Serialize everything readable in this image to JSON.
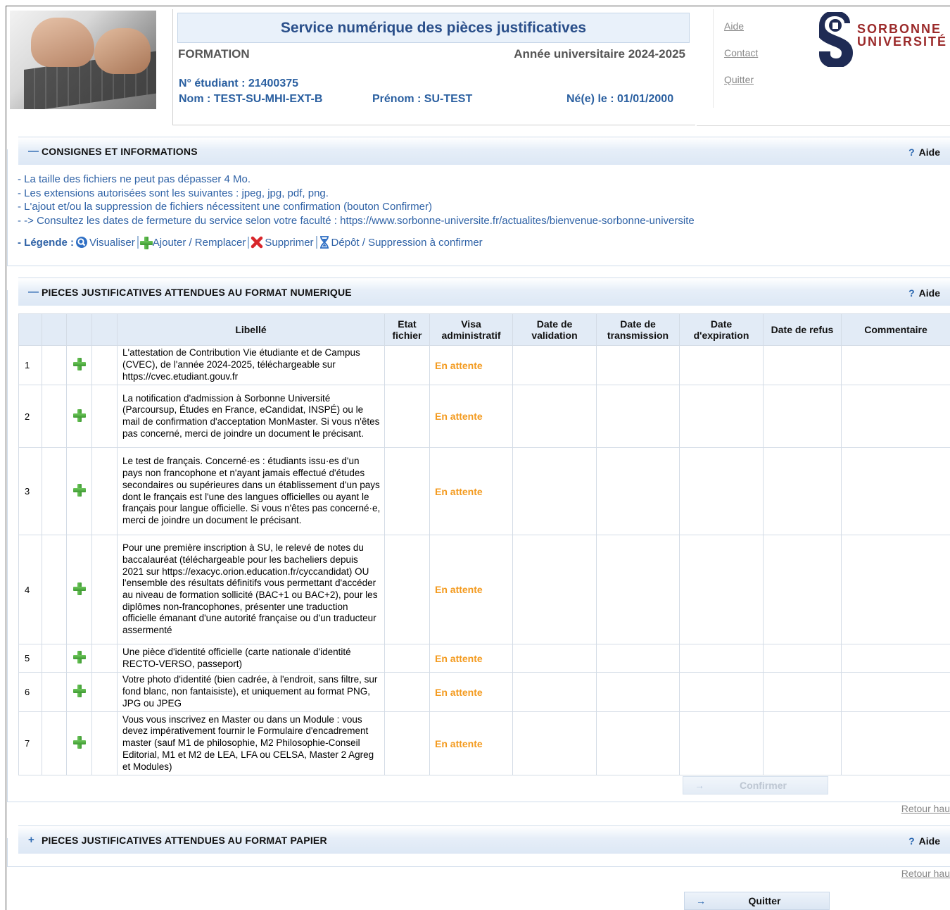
{
  "header": {
    "title": "Service numérique des pièces justificatives",
    "formation": "FORMATION",
    "annee": "Année universitaire 2024-2025",
    "numero_etudiant": "N° étudiant : 21400375",
    "nom": "Nom : TEST-SU-MHI-EXT-B",
    "prenom": "Prénom : SU-TEST",
    "naissance": "Né(e) le : 01/01/2000"
  },
  "links": {
    "aide": "Aide",
    "contact": "Contact",
    "quitter": "Quitter"
  },
  "logo": {
    "line1": "SORBONNE",
    "line2": "UNIVERSITÉ",
    "color": "#9b2a2a"
  },
  "sections": {
    "consignes": {
      "toggle": "—",
      "title": "CONSIGNES ET INFORMATIONS",
      "aide": "Aide",
      "aide_q": "?"
    },
    "numerique": {
      "toggle": "—",
      "title": "PIECES JUSTIFICATIVES ATTENDUES AU FORMAT NUMERIQUE",
      "aide": "Aide",
      "aide_q": "?"
    },
    "papier": {
      "toggle": "+",
      "title": "PIECES JUSTIFICATIVES ATTENDUES AU FORMAT PAPIER",
      "aide": "Aide",
      "aide_q": "?"
    }
  },
  "consignes": [
    "- La taille des fichiers ne peut pas dépasser 4 Mo.",
    "- Les extensions autorisées sont les suivantes : jpeg, jpg, pdf, png.",
    "- L'ajout et/ou la suppression de fichiers nécessitent une confirmation (bouton Confirmer)",
    "- -> Consultez les dates de fermeture du service selon votre faculté : https://www.sorbonne-universite.fr/actualites/bienvenue-sorbonne-universite"
  ],
  "legend": {
    "label": "- Légende :",
    "visualiser": "Visualiser",
    "ajouter": "Ajouter / Remplacer",
    "supprimer": "Supprimer",
    "depot": "Dépôt / Suppression à confirmer"
  },
  "table": {
    "headers": {
      "libelle": "Libellé",
      "etat": "Etat fichier",
      "visa": "Visa administratif",
      "validation": "Date de validation",
      "transmission": "Date de transmission",
      "expiration": "Date d'expiration",
      "refus": "Date de refus",
      "commentaire": "Commentaire"
    },
    "rows": [
      {
        "num": "1",
        "libelle": "L'attestation de Contribution Vie étudiante et de Campus (CVEC), de l'année 2024-2025, téléchargeable sur https://cvec.etudiant.gouv.fr",
        "visa": "En attente"
      },
      {
        "num": "2",
        "libelle": "La notification d'admission à Sorbonne Université (Parcoursup, Études en France, eCandidat, INSPÉ) ou le mail de confirmation d'acceptation MonMaster. Si vous n'êtes pas concerné, merci de joindre un document le précisant.",
        "visa": "En attente"
      },
      {
        "num": "3",
        "libelle": "Le test de français. Concerné·es : étudiants issu·es d'un pays non francophone et n'ayant jamais effectué d'études secondaires ou supérieures dans un établissement d'un pays dont le français est l'une des langues officielles ou ayant le français pour langue officielle. Si vous n'êtes pas concerné·e, merci de joindre un document le précisant.",
        "visa": "En attente"
      },
      {
        "num": "4",
        "libelle": "Pour une première inscription à SU, le relevé de notes du baccalauréat (téléchargeable pour les bacheliers depuis 2021 sur https://exacyc.orion.education.fr/cyccandidat) OU l'ensemble des résultats définitifs vous permettant d'accéder au niveau de formation sollicité (BAC+1 ou BAC+2), pour les diplômes non-francophones, présenter une traduction officielle émanant d'une autorité française ou d'un traducteur assermenté",
        "visa": "En attente"
      },
      {
        "num": "5",
        "libelle": "Une pièce d'identité officielle (carte nationale d'identité RECTO-VERSO, passeport)",
        "visa": "En attente"
      },
      {
        "num": "6",
        "libelle": "Votre photo d'identité (bien cadrée, à l'endroit, sans filtre, sur fond blanc, non fantaisiste), et uniquement au format PNG, JPG ou JPEG",
        "visa": "En attente"
      },
      {
        "num": "7",
        "libelle": "Vous vous inscrivez en Master ou dans un Module : vous devez impérativement fournir le Formulaire d'encadrement master (sauf M1 de philosophie, M2 Philosophie-Conseil Editorial, M1 et M2 de LEA, LFA ou CELSA, Master 2 Agreg et Modules)",
        "visa": "En attente"
      }
    ]
  },
  "buttons": {
    "confirmer": "Confirmer",
    "quitter": "Quitter",
    "arrow": "→"
  },
  "retour": "Retour hau",
  "colors": {
    "accent": "#2a67b0",
    "pending": "#f39a1e",
    "header_bg": "#e2ebf6"
  }
}
